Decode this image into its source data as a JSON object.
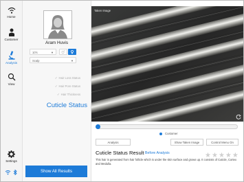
{
  "nav": {
    "home": "Home",
    "customer": "Customer",
    "analysis": "Analysis",
    "view": "View",
    "settings": "Settings"
  },
  "profile": {
    "name": "Aram Huvis",
    "age": "10's",
    "scalp": "Scalp"
  },
  "status_items": [
    "Hair Loss Status",
    "Hair Pore Status",
    "Hair Thickness"
  ],
  "current_status": "Cuticle Status",
  "show_all": "Show All Results",
  "viewer": {
    "title": "Taken Image"
  },
  "radio_label": "Customer",
  "buttons": {
    "analysis": "Analysis",
    "show_taken": "Show Taken Image",
    "control_menu": "Control Menu On"
  },
  "result": {
    "title": "Cuticle Status Result",
    "link": "Before Analysis",
    "rating": 0,
    "description": "This hair is generated from hair follicle which is under the skin surface and grows up. It consists of Cuticle, Cortex and Medulla."
  },
  "colors": {
    "accent": "#1d7bd8"
  }
}
